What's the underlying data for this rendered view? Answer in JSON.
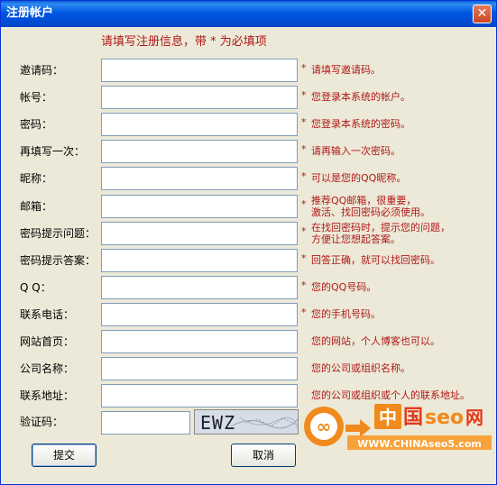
{
  "window": {
    "title": "注册帐户",
    "close_symbol": "✕"
  },
  "instruction": "请填写注册信息，带 * 为必填项",
  "fields": [
    {
      "label": "邀请码：",
      "required": true,
      "hint1": "请填写邀请码。",
      "hint2": ""
    },
    {
      "label": "帐号：",
      "required": true,
      "hint1": "您登录本系统的帐户。",
      "hint2": ""
    },
    {
      "label": "密码：",
      "required": true,
      "hint1": "您登录本系统的密码。",
      "hint2": ""
    },
    {
      "label": "再填写一次：",
      "required": true,
      "hint1": "请再输入一次密码。",
      "hint2": ""
    },
    {
      "label": "昵称：",
      "required": true,
      "hint1": "可以是您的QQ昵称。",
      "hint2": ""
    },
    {
      "label": "邮箱：",
      "required": true,
      "hint1": "推荐QQ邮箱，很重要，",
      "hint2": "激活、找回密码必须使用。"
    },
    {
      "label": "密码提示问题：",
      "required": true,
      "hint1": "在找回密码时，提示您的问题，",
      "hint2": "方便让您想起答案。"
    },
    {
      "label": "密码提示答案：",
      "required": true,
      "hint1": "回答正确，就可以找回密码。",
      "hint2": ""
    },
    {
      "label": "Q  Q：",
      "required": true,
      "hint1": "您的QQ号码。",
      "hint2": ""
    },
    {
      "label": "联系电话：",
      "required": true,
      "hint1": "您的手机号码。",
      "hint2": ""
    },
    {
      "label": "网站首页：",
      "required": false,
      "hint1": "您的网站，个人博客也可以。",
      "hint2": ""
    },
    {
      "label": "公司名称：",
      "required": false,
      "hint1": "您的公司或组织名称。",
      "hint2": ""
    },
    {
      "label": "联系地址：",
      "required": false,
      "hint1": "您的公司或组织或个人的联系地址。",
      "hint2": ""
    }
  ],
  "captcha": {
    "label": "验证码：",
    "image_text": "EWZ"
  },
  "buttons": {
    "submit": "提交",
    "cancel": "取消"
  },
  "watermark": {
    "brand_cn": "中国seo网",
    "url": "WWW.CHINAseo5.com"
  },
  "required_mark": "*",
  "colors": {
    "title_bar": "#0054e3",
    "hint_red": "#b01818",
    "face": "#ece9d8",
    "logo_orange": "#f08a1c"
  }
}
